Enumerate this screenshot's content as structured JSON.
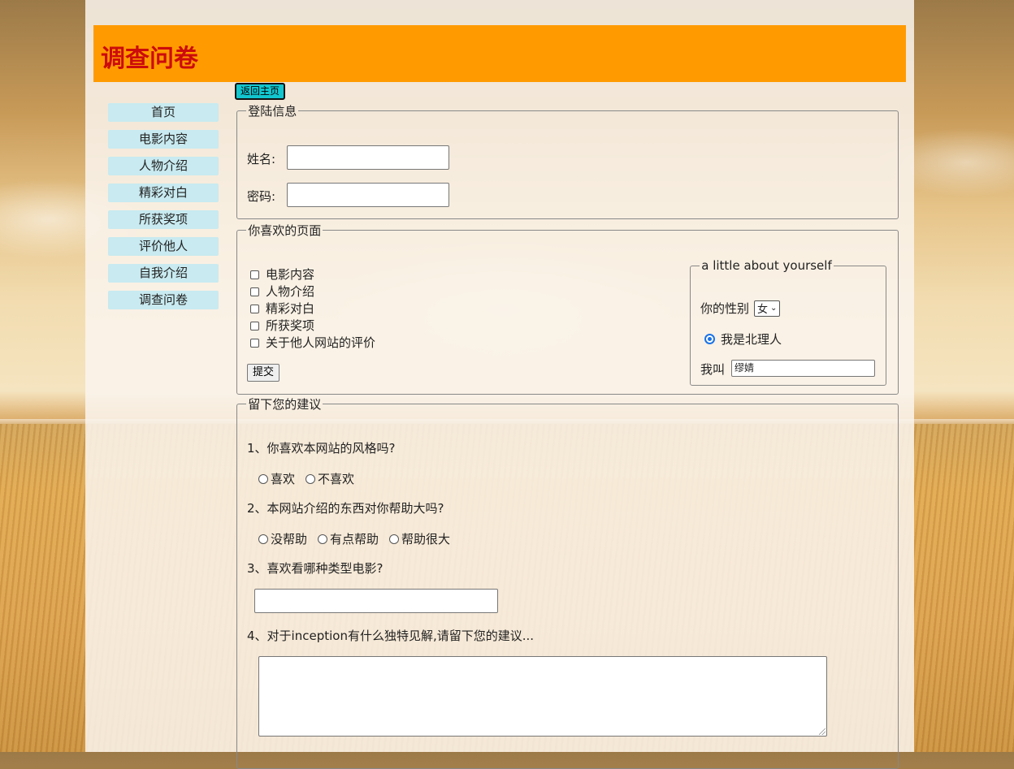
{
  "page_title": "调查问卷",
  "nav": {
    "items": [
      "首页",
      "电影内容",
      "人物介绍",
      "精彩对白",
      "所获奖项",
      "评价他人",
      "自我介绍",
      "调查问卷"
    ]
  },
  "home_button": "返回主页",
  "login": {
    "legend": "登陆信息",
    "name_label": "姓名:",
    "password_label": "密码:"
  },
  "favorites": {
    "legend": "你喜欢的页面",
    "options": [
      "电影内容",
      "人物介绍",
      "精彩对白",
      "所获奖项",
      "关于他人网站的评价"
    ],
    "submit": "提交"
  },
  "about": {
    "legend": "a little about yourself",
    "gender_label": "你的性别",
    "gender_value": "女",
    "radio_label": "我是北理人",
    "name_label": "我叫",
    "name_value": "缪婧"
  },
  "suggestions": {
    "legend": "留下您的建议",
    "q1": "1、你喜欢本网站的风格吗?",
    "q1_options": [
      "喜欢",
      "不喜欢"
    ],
    "q2": "2、本网站介绍的东西对你帮助大吗?",
    "q2_options": [
      "没帮助",
      "有点帮助",
      "帮助很大"
    ],
    "q3": "3、喜欢看哪种类型电影?",
    "q4": "4、对于inception有什么独特见解,请留下您的建议..."
  },
  "colors": {
    "banner": "#ff9b00",
    "title": "#cc0b0b",
    "nav_bg": "#c8eaf0",
    "home_button": "#12c6cf"
  }
}
